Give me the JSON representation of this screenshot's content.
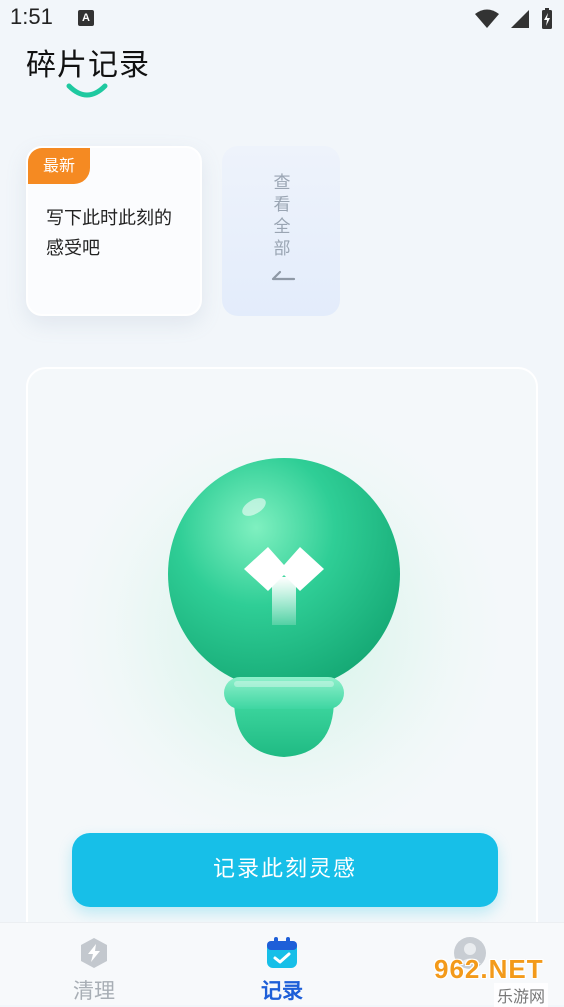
{
  "status": {
    "time": "1:51",
    "notification_letter": "A"
  },
  "page": {
    "title": "碎片记录"
  },
  "note_card": {
    "badge": "最新",
    "text": "写下此时此刻的感受吧"
  },
  "view_all": {
    "label": "查看全部"
  },
  "main": {
    "record_button": "记录此刻灵感"
  },
  "nav": {
    "items": [
      {
        "label": "清理",
        "icon": "bolt-icon",
        "active": false
      },
      {
        "label": "记录",
        "icon": "calendar-check-icon",
        "active": true
      },
      {
        "label": "",
        "icon": "avatar-icon",
        "active": false
      }
    ]
  },
  "watermark": {
    "text": "962.NET",
    "sub": "乐游网"
  },
  "colors": {
    "accent_blue": "#17bfe8",
    "badge_orange": "#f58a22",
    "bulb_green": "#2fce96",
    "nav_active": "#1e5fd8"
  }
}
